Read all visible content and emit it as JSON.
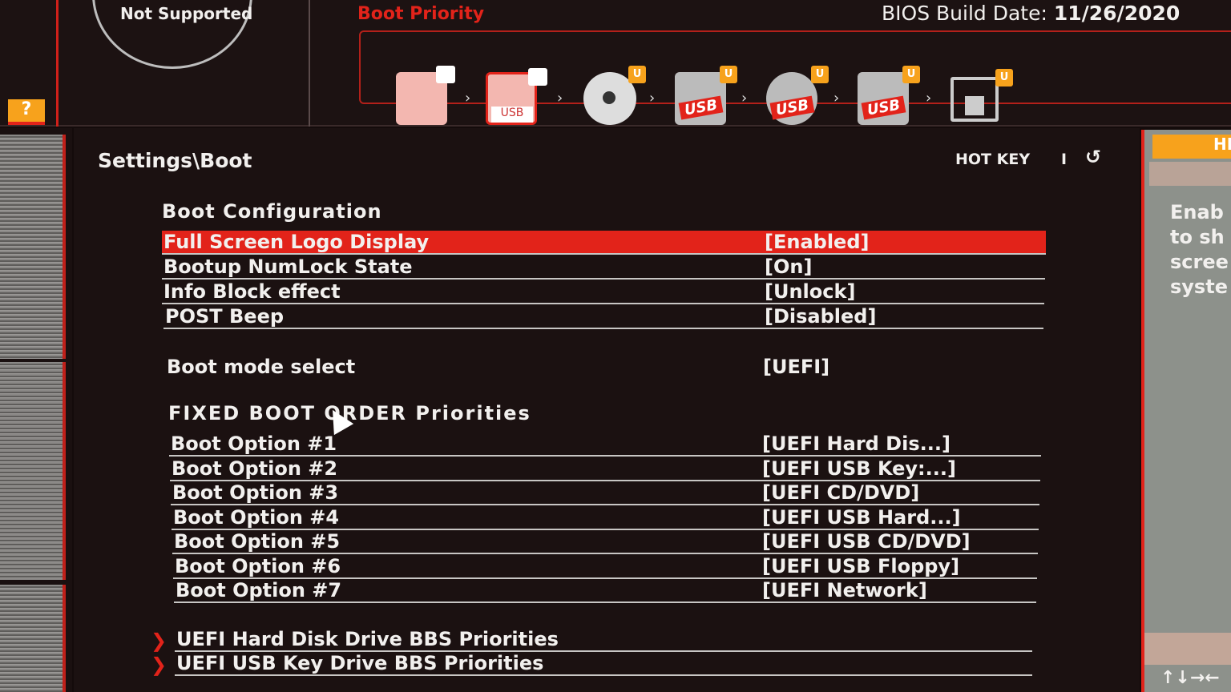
{
  "header": {
    "cpu_status": "Not Supported",
    "help_badge": "?",
    "boot_priority_title": "Boot Priority",
    "build_date_label": "BIOS Build Date:",
    "build_date": "11/26/2020",
    "boot_devices": [
      {
        "icon": "hard-disk-icon"
      },
      {
        "icon": "usb-key-icon",
        "label": "USB",
        "badge": ""
      },
      {
        "icon": "cd-dvd-icon",
        "badge": "U"
      },
      {
        "icon": "usb-hard-disk-icon",
        "label": "USB",
        "badge": "U"
      },
      {
        "icon": "usb-cd-icon",
        "label": "USB",
        "badge": "U"
      },
      {
        "icon": "usb-floppy-icon",
        "label": "USB",
        "badge": "U"
      },
      {
        "icon": "network-icon",
        "badge": "U"
      }
    ]
  },
  "main": {
    "breadcrumb": "Settings\\Boot",
    "hotkey": "HOT KEY",
    "hotkey_sep": "I",
    "back_icon": "undo-arrow-icon",
    "boot_config_title": "Boot  Configuration",
    "config_rows": [
      {
        "label": "Full Screen Logo Display",
        "value": "[Enabled]"
      },
      {
        "label": "Bootup NumLock State",
        "value": "[On]"
      },
      {
        "label": "Info Block effect",
        "value": "[Unlock]"
      },
      {
        "label": "POST Beep",
        "value": "[Disabled]"
      }
    ],
    "boot_mode": {
      "label": "Boot mode select",
      "value": "[UEFI]"
    },
    "fixed_title": "FIXED  BOOT  ORDER  Priorities",
    "boot_options": [
      {
        "label": "Boot Option #1",
        "value": "[UEFI Hard Dis...]"
      },
      {
        "label": "Boot Option #2",
        "value": "[UEFI USB Key:...]"
      },
      {
        "label": "Boot Option #3",
        "value": "[UEFI CD/DVD]"
      },
      {
        "label": "Boot Option #4",
        "value": "[UEFI USB Hard...]"
      },
      {
        "label": "Boot Option #5",
        "value": "[UEFI USB CD/DVD]"
      },
      {
        "label": "Boot Option #6",
        "value": "[UEFI USB Floppy]"
      },
      {
        "label": "Boot Option #7",
        "value": "[UEFI Network]"
      }
    ],
    "submenus": [
      "UEFI Hard Disk Drive BBS Priorities",
      "UEFI USB Key Drive BBS Priorities"
    ]
  },
  "help": {
    "tab": "HE",
    "text": [
      "Enab",
      "to sh",
      "scree",
      "syste"
    ],
    "nav_hint": "↑↓→←"
  },
  "colors": {
    "accent": "#e2231a",
    "badge": "#f7a21c",
    "panel": "#1b1111",
    "help_bg": "#8d918b"
  }
}
